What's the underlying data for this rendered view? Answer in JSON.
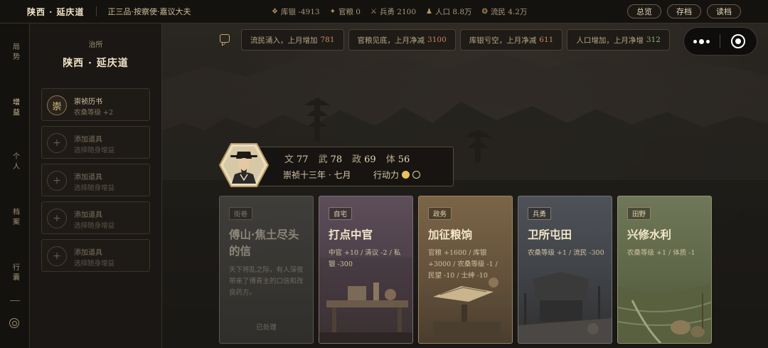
{
  "topbar": {
    "location": "陕西 · 延庆道",
    "rank": "正三品·按察使·嘉议大夫",
    "stats": [
      {
        "icon": "silver-icon",
        "label": "库银 -4913"
      },
      {
        "icon": "grain-icon",
        "label": "官粮 0"
      },
      {
        "icon": "soldier-icon",
        "label": "兵勇 2100"
      },
      {
        "icon": "population-icon",
        "label": "人口 8.8万"
      },
      {
        "icon": "refugee-icon",
        "label": "流民 4.2万"
      }
    ],
    "buttons": {
      "overview": "总览",
      "save": "存档",
      "load": "读档"
    }
  },
  "rail": {
    "items": [
      "局势",
      "增益",
      "个人",
      "档案",
      "行囊"
    ],
    "active_index": 1
  },
  "side": {
    "label": "治所",
    "title": "陕西 · 延庆道",
    "slots": [
      {
        "badge": "崇",
        "name": "崇祯历书",
        "desc": "农桑等级 +2"
      },
      {
        "name": "添加道具",
        "desc": "选择随身增益"
      },
      {
        "name": "添加道具",
        "desc": "选择随身增益"
      },
      {
        "name": "添加道具",
        "desc": "选择随身增益"
      },
      {
        "name": "添加道具",
        "desc": "选择随身增益"
      }
    ]
  },
  "notices": [
    {
      "text": "流民涌入，上月增加",
      "value": "781",
      "tone": "red"
    },
    {
      "text": "官粮见底，上月净减",
      "value": "3100",
      "tone": "red"
    },
    {
      "text": "库银亏空，上月净减",
      "value": "611",
      "tone": "red"
    },
    {
      "text": "人口增加，上月净增",
      "value": "312",
      "tone": "green"
    }
  ],
  "character": {
    "attrs": [
      {
        "label": "文",
        "value": "77"
      },
      {
        "label": "武",
        "value": "78"
      },
      {
        "label": "政",
        "value": "69"
      },
      {
        "label": "体",
        "value": "56"
      }
    ],
    "date": "崇祯十三年 · 七月",
    "action_label": "行动力",
    "action_points": {
      "used": 1,
      "total": 2
    }
  },
  "cards": [
    {
      "tag": "街巷",
      "title": "傅山·焦土尽头的信",
      "desc": "天下将乱之际，有人深夜带来了傅青主的口信和改良药方。",
      "status": "已处理",
      "theme": "done"
    },
    {
      "tag": "自宅",
      "title": "打点中官",
      "desc": "中官 +10 / 清议 -2 / 私银 -300",
      "theme": "purple"
    },
    {
      "tag": "政务",
      "title": "加征粮饷",
      "desc": "官粮 +1600 / 库银 +3000 / 农桑等级 -1 / 民望 -10 / 士绅 -10",
      "theme": "brown"
    },
    {
      "tag": "兵勇",
      "title": "卫所屯田",
      "desc": "农桑等级 +1 / 流民 -300",
      "theme": "slate"
    },
    {
      "tag": "田野",
      "title": "兴修水利",
      "desc": "农桑等级 +1 / 体质 -1",
      "theme": "green"
    }
  ]
}
